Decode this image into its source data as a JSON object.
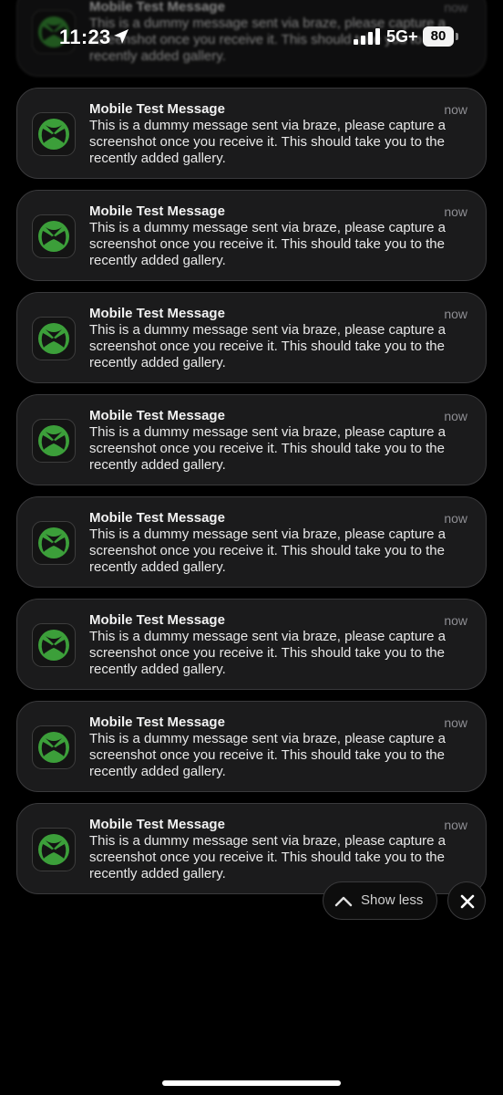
{
  "status_bar": {
    "time": "11:23",
    "network": "5G+",
    "battery_level": "80"
  },
  "notifications": [
    {
      "app_icon": "xbox-icon",
      "title": "Mobile Test Message",
      "time": "now",
      "body": "This is a dummy message sent via braze, please capture a screenshot once you receive it. This should take you to the recently added gallery."
    },
    {
      "app_icon": "xbox-icon",
      "title": "Mobile Test Message",
      "time": "now",
      "body": "This is a dummy message sent via braze, please capture a screenshot once you receive it. This should take you to the recently added gallery."
    },
    {
      "app_icon": "xbox-icon",
      "title": "Mobile Test Message",
      "time": "now",
      "body": "This is a dummy message sent via braze, please capture a screenshot once you receive it. This should take you to the recently added gallery."
    },
    {
      "app_icon": "xbox-icon",
      "title": "Mobile Test Message",
      "time": "now",
      "body": "This is a dummy message sent via braze, please capture a screenshot once you receive it. This should take you to the recently added gallery."
    },
    {
      "app_icon": "xbox-icon",
      "title": "Mobile Test Message",
      "time": "now",
      "body": "This is a dummy message sent via braze, please capture a screenshot once you receive it. This should take you to the recently added gallery."
    },
    {
      "app_icon": "xbox-icon",
      "title": "Mobile Test Message",
      "time": "now",
      "body": "This is a dummy message sent via braze, please capture a screenshot once you receive it. This should take you to the recently added gallery."
    },
    {
      "app_icon": "xbox-icon",
      "title": "Mobile Test Message",
      "time": "now",
      "body": "This is a dummy message sent via braze, please capture a screenshot once you receive it. This should take you to the recently added gallery."
    },
    {
      "app_icon": "xbox-icon",
      "title": "Mobile Test Message",
      "time": "now",
      "body": "This is a dummy message sent via braze, please capture a screenshot once you receive it. This should take you to the recently added gallery."
    },
    {
      "app_icon": "xbox-icon",
      "title": "Mobile Test Message",
      "time": "now",
      "body": "This is a dummy message sent via braze, please capture a screenshot once you receive it. This should take you to the recently added gallery."
    }
  ],
  "controls": {
    "show_less_label": "Show less",
    "show_less_icon": "chevron-up-icon",
    "close_icon": "close-icon"
  },
  "colors": {
    "background": "#000000",
    "notification_background": "#1b1b1c",
    "xbox_green": "#3c9f3a"
  }
}
